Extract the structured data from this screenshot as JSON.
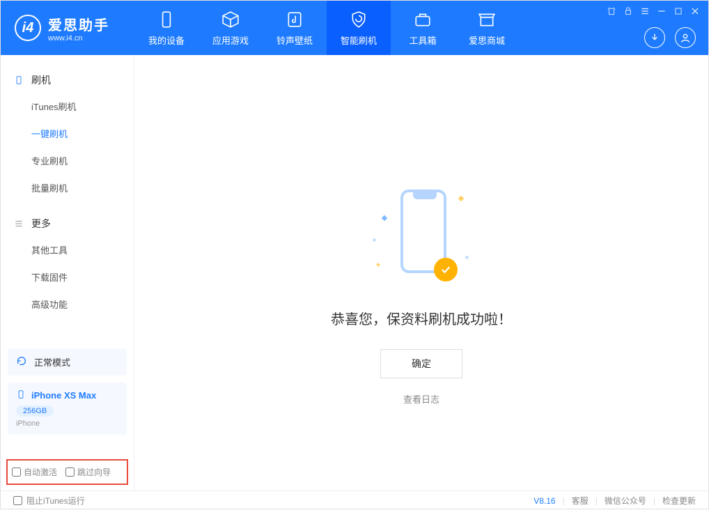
{
  "app": {
    "logo_text": "爱思助手",
    "logo_url": "www.i4.cn"
  },
  "nav": [
    {
      "label": "我的设备",
      "icon": "device"
    },
    {
      "label": "应用游戏",
      "icon": "cube"
    },
    {
      "label": "铃声壁纸",
      "icon": "music"
    },
    {
      "label": "智能刷机",
      "icon": "shield",
      "active": true
    },
    {
      "label": "工具箱",
      "icon": "toolbox"
    },
    {
      "label": "爱思商城",
      "icon": "store"
    }
  ],
  "sidebar": {
    "section1_title": "刷机",
    "items1": [
      {
        "label": "iTunes刷机"
      },
      {
        "label": "一键刷机",
        "active": true
      },
      {
        "label": "专业刷机"
      },
      {
        "label": "批量刷机"
      }
    ],
    "section2_title": "更多",
    "items2": [
      {
        "label": "其他工具"
      },
      {
        "label": "下载固件"
      },
      {
        "label": "高级功能"
      }
    ],
    "mode": "正常模式",
    "device": {
      "name": "iPhone XS Max",
      "storage": "256GB",
      "type": "iPhone"
    },
    "check_auto_activate": "自动激活",
    "check_skip_guide": "跳过向导"
  },
  "main": {
    "success_title": "恭喜您，保资料刷机成功啦！",
    "ok_button": "确定",
    "view_log": "查看日志"
  },
  "footer": {
    "block_itunes": "阻止iTunes运行",
    "version": "V8.16",
    "customer_service": "客服",
    "wechat": "微信公众号",
    "check_update": "检查更新"
  }
}
